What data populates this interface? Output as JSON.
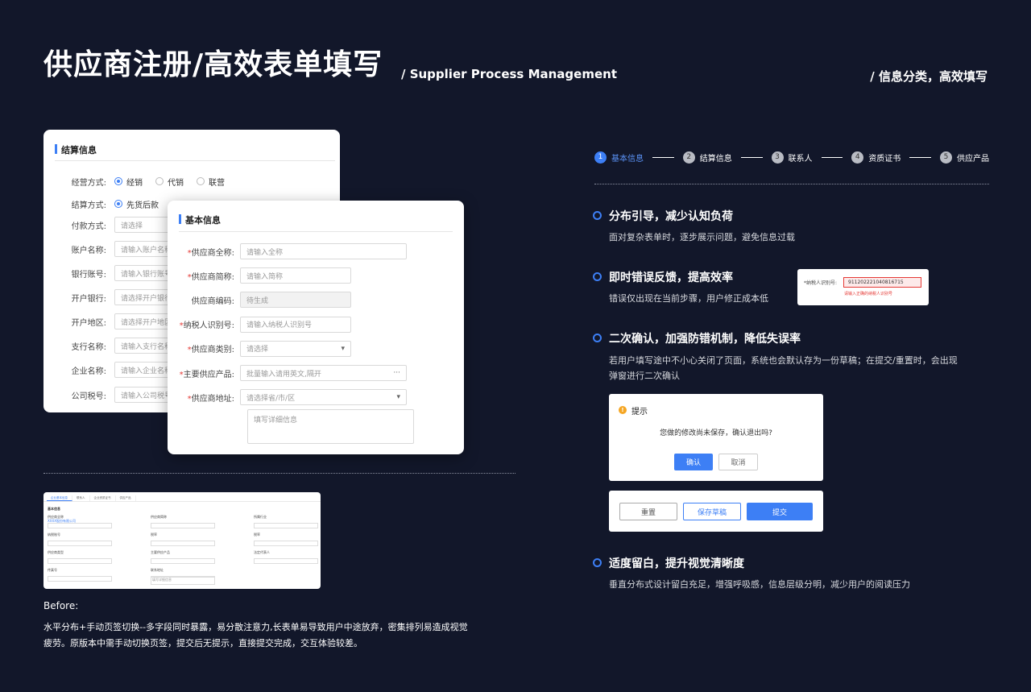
{
  "header": {
    "title": "供应商注册/高效表单填写",
    "subtitle": "/ Supplier Process Management",
    "tagline": "/ 信息分类，高效填写"
  },
  "settlement_card": {
    "title": "结算信息",
    "rows": [
      {
        "label": "经营方式:",
        "type": "radio",
        "options": [
          "经销",
          "代销",
          "联营"
        ],
        "selected": 0
      },
      {
        "label": "结算方式:",
        "type": "radio",
        "options": [
          "先货后款"
        ],
        "selected": 0
      },
      {
        "label": "付款方式:",
        "placeholder": "请选择"
      },
      {
        "label": "账户名称:",
        "placeholder": "请输入账户名称"
      },
      {
        "label": "银行账号:",
        "placeholder": "请输入银行账号"
      },
      {
        "label": "开户银行:",
        "placeholder": "请选择开户银行"
      },
      {
        "label": "开户地区:",
        "placeholder": "请选择开户地区"
      },
      {
        "label": "支行名称:",
        "placeholder": "请输入支行名称"
      },
      {
        "label": "企业名称:",
        "placeholder": "请输入企业名称"
      },
      {
        "label": "公司税号:",
        "placeholder": "请输入公司税号"
      }
    ]
  },
  "basic_card": {
    "title": "基本信息",
    "rows": [
      {
        "label": "供应商全称:",
        "required": true,
        "placeholder": "请输入全称",
        "width": "wide"
      },
      {
        "label": "供应商简称:",
        "required": true,
        "placeholder": "请输入简称",
        "width": "narrow"
      },
      {
        "label": "供应商编码:",
        "required": false,
        "placeholder": "待生成",
        "width": "narrow",
        "disabled": true
      },
      {
        "label": "纳税人识别号:",
        "required": true,
        "placeholder": "请输入纳税人识别号",
        "width": "narrow"
      },
      {
        "label": "供应商类别:",
        "required": true,
        "placeholder": "请选择",
        "width": "narrow",
        "suffix": "▾"
      },
      {
        "label": "主要供应产品:",
        "required": true,
        "placeholder": "批量输入请用英文,隔开",
        "width": "wide",
        "suffix": "···"
      },
      {
        "label": "供应商地址:",
        "required": true,
        "placeholder": "请选择省/市/区",
        "width": "wide",
        "suffix": "▾"
      }
    ],
    "address_detail": "填写详细信息"
  },
  "before": {
    "label": "Before:",
    "text_line1": "水平分布+手动页签切换--多字段同时暴露，易分散注意力,长表单易导致用户中途放弃，密集排列易造成视觉",
    "text_line2": "疲劳。原版本中需手动切换页签，提交后无提示，直接提交完成，交互体验较差。",
    "thumb": {
      "tabs": [
        "企业基本信息",
        "联系人",
        "企业资质证书",
        "供应产品"
      ],
      "section": "基本信息",
      "fields": [
        {
          "label": "供应商全称",
          "value": "XXXX股份有限公司",
          "col": 0,
          "row": 0
        },
        {
          "label": "供应商简称",
          "col": 1,
          "row": 0
        },
        {
          "label": "所属行业",
          "col": 2,
          "row": 0
        },
        {
          "label": "纳税账号",
          "col": 0,
          "row": 1
        },
        {
          "label": "税率",
          "col": 1,
          "row": 1
        },
        {
          "label": "税率",
          "col": 2,
          "row": 1
        },
        {
          "label": "供应商类型",
          "col": 0,
          "row": 2
        },
        {
          "label": "主要供应产品",
          "col": 1,
          "row": 2
        },
        {
          "label": "法定代表人",
          "col": 2,
          "row": 2
        },
        {
          "label": "传真号",
          "col": 0,
          "row": 3
        },
        {
          "label": "联系地址",
          "col": 1,
          "row": 3
        }
      ],
      "address_detail": "填写详细信息"
    }
  },
  "steps": [
    {
      "num": "1",
      "label": "基本信息",
      "active": true
    },
    {
      "num": "2",
      "label": "结算信息"
    },
    {
      "num": "3",
      "label": "联系人"
    },
    {
      "num": "4",
      "label": "资质证书"
    },
    {
      "num": "5",
      "label": "供应产品"
    }
  ],
  "features": [
    {
      "head": "分布引导，减少认知负荷",
      "desc": [
        "面对复杂表单时，逐步展示问题，避免信息过载"
      ]
    },
    {
      "head": "即时错误反馈，提高效率",
      "desc": [
        "错误仅出现在当前步骤，用户修正成本低"
      ]
    },
    {
      "head": "二次确认，加强防错机制，降低失误率",
      "desc": [
        "若用户填写途中不小心关闭了页面，系统也会默认存为一份草稿；在提交/重置时，会出现",
        "弹窗进行二次确认"
      ]
    },
    {
      "head": "适度留白，提升视觉清晰度",
      "desc": [
        "垂直分布式设计留白充足，增强呼吸感，信息层级分明，减少用户的阅读压力"
      ]
    }
  ],
  "error_demo": {
    "label": "*纳税人识别号:",
    "value": "911202221040816715",
    "error": "请输入正确的纳税人识别号"
  },
  "dialog": {
    "title": "提示",
    "message": "您做的修改尚未保存，确认退出吗?",
    "confirm": "确认",
    "cancel": "取消"
  },
  "action_bar": {
    "reset": "重置",
    "save_draft": "保存草稿",
    "submit": "提交"
  },
  "colors": {
    "background": "#12172a",
    "accent": "#3d7ff5",
    "error": "#e53935",
    "warning": "#f5a623"
  }
}
